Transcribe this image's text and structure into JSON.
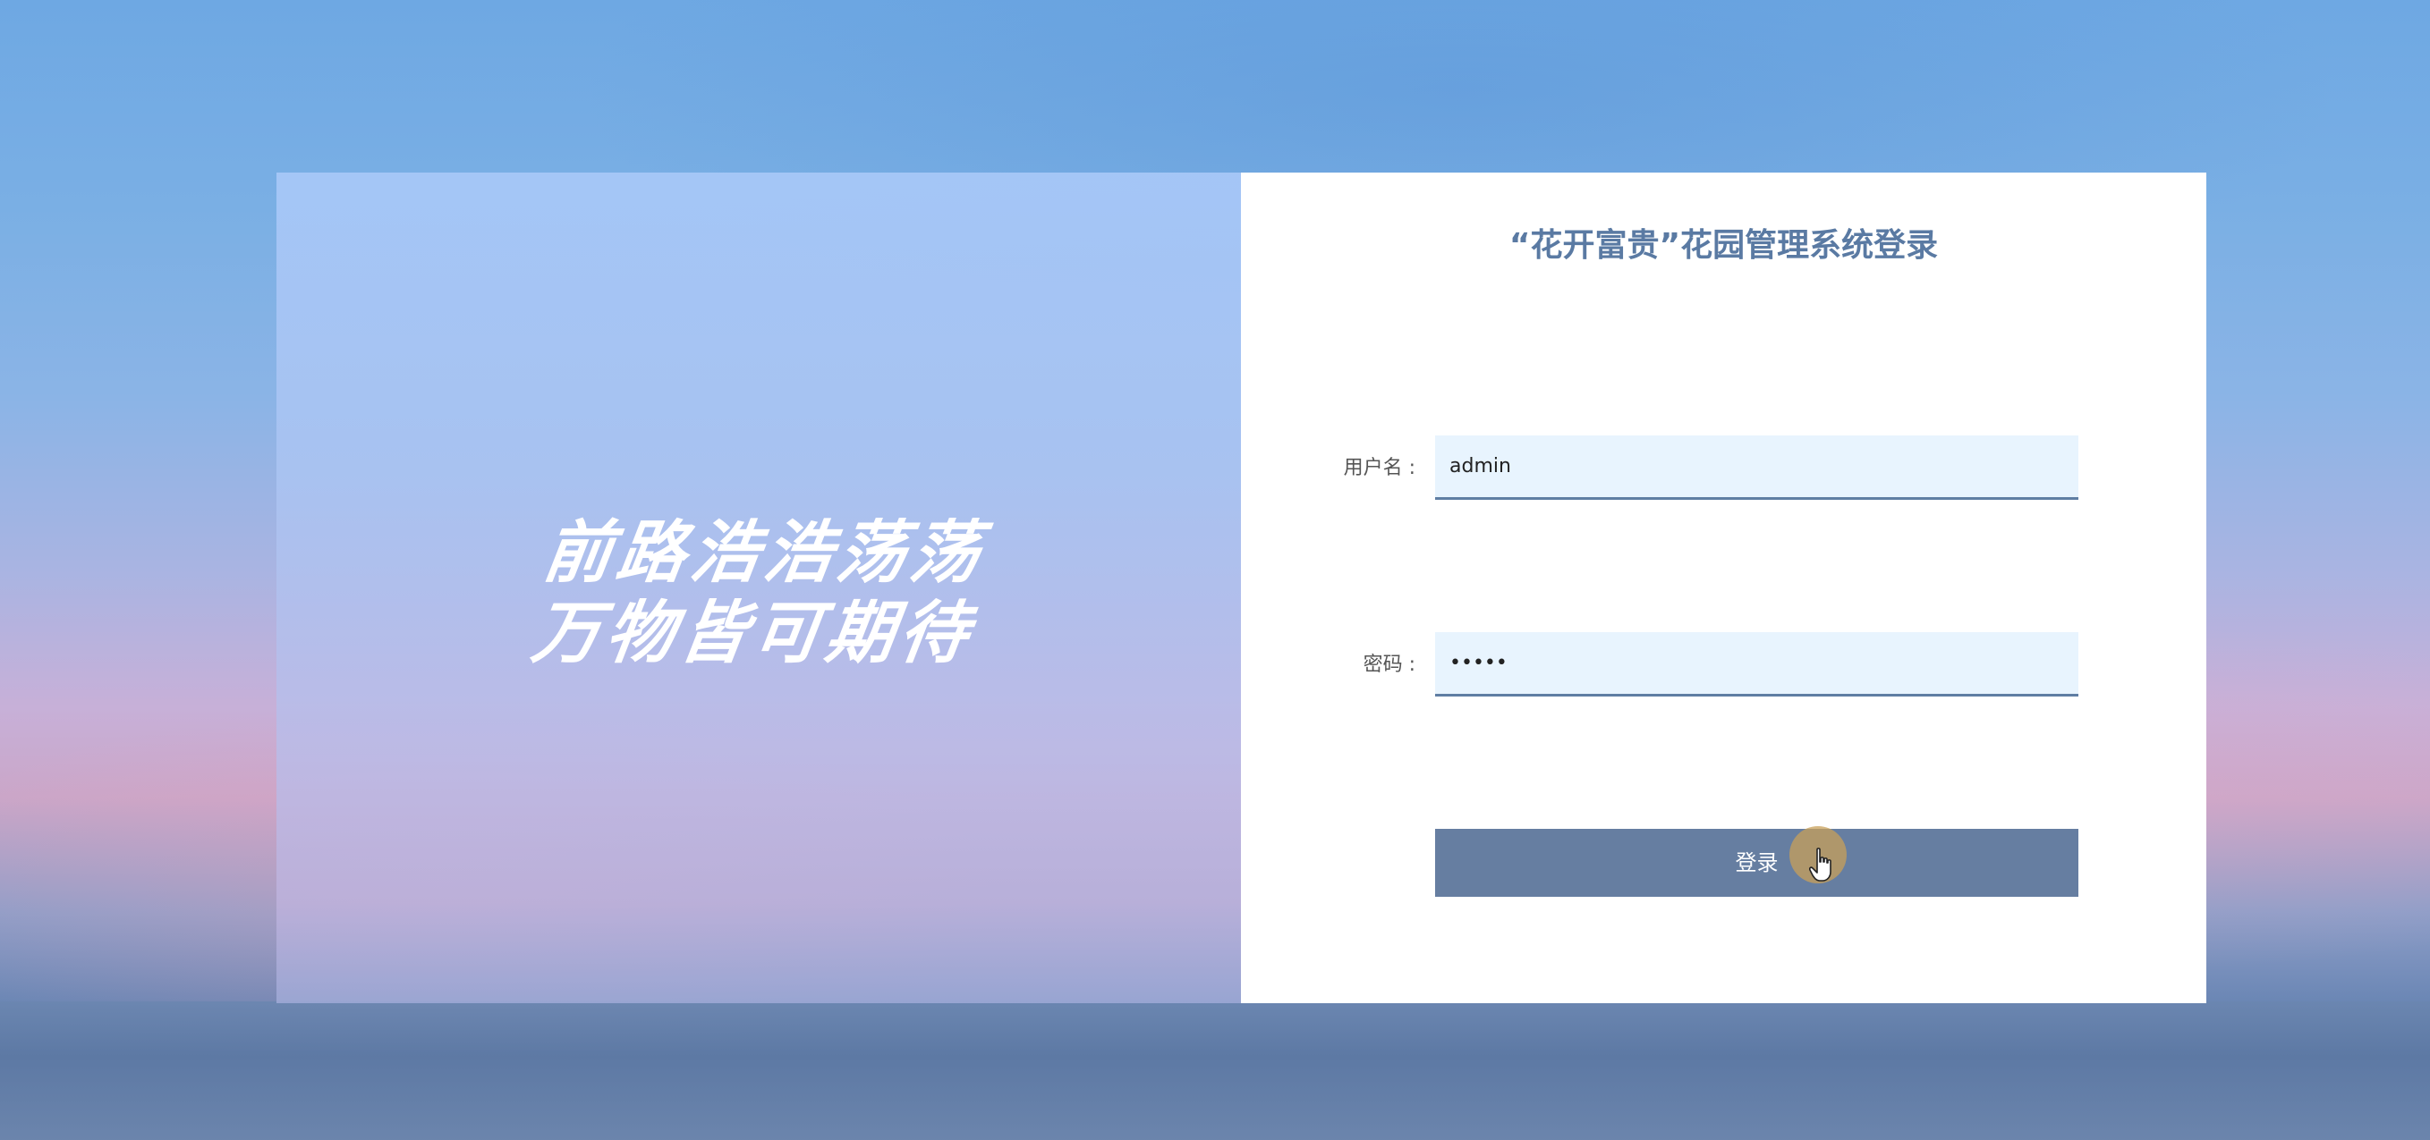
{
  "left_panel": {
    "slogan_line1": "前路浩浩荡荡",
    "slogan_line2": "万物皆可期待"
  },
  "login": {
    "title": "“花开富贵”花园管理系统登录",
    "username_label": "用户名 :",
    "username_value": "admin",
    "password_label": "密码 :",
    "password_value": "•••••",
    "submit_label": "登录"
  },
  "colors": {
    "title": "#5a7aa3",
    "input_bg": "#e8f4fe",
    "input_border": "#5f7ea3",
    "button_bg": "#667ea1",
    "button_text": "#ffffff"
  },
  "icons": {
    "cursor": "hand-pointer-icon"
  }
}
